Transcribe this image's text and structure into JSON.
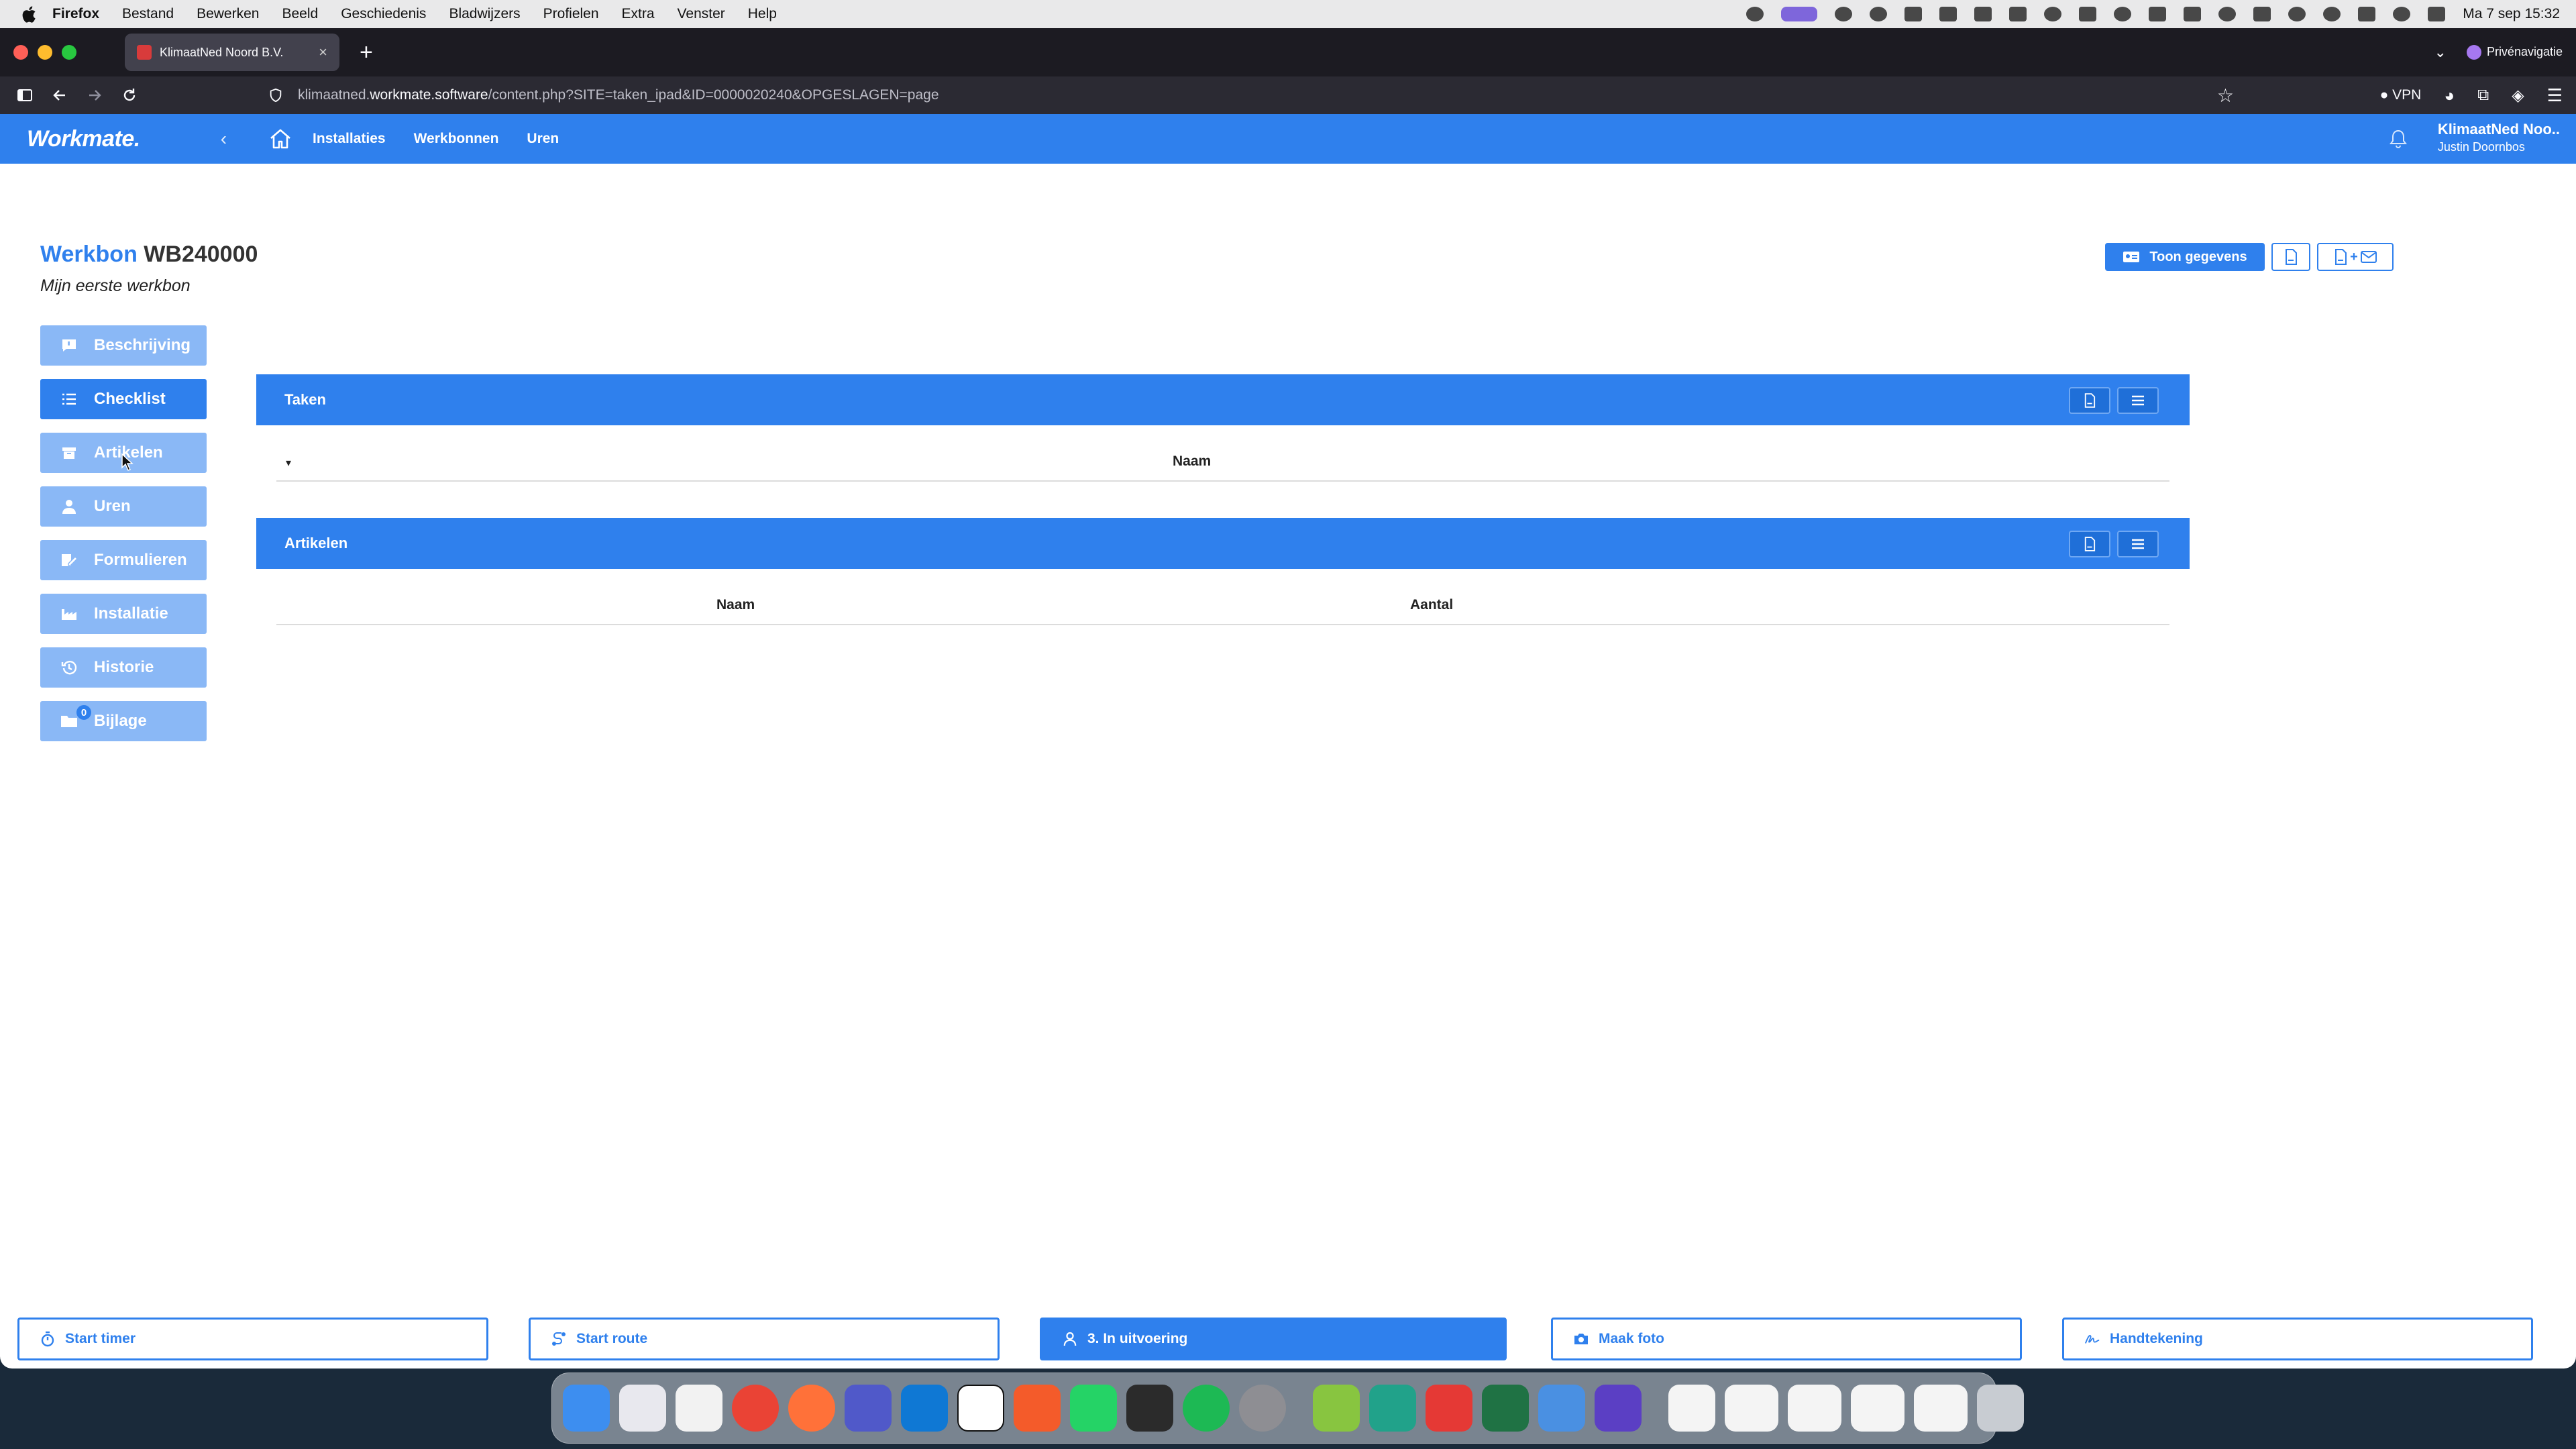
{
  "menubar": {
    "app": "Firefox",
    "items": [
      "Bestand",
      "Bewerken",
      "Beeld",
      "Geschiedenis",
      "Bladwijzers",
      "Profielen",
      "Extra",
      "Venster",
      "Help"
    ],
    "clock": "Ma 7 sep  15:32"
  },
  "browser": {
    "tab_title": "KlimaatNed Noord B.V.",
    "private_label": "Privénavigatie",
    "url_prefix": "klimaatned.",
    "url_host": "workmate.software",
    "url_path": "/content.php?SITE=taken_ipad&ID=0000020240&OPGESLAGEN=page",
    "vpn_label": "VPN"
  },
  "app": {
    "logo": "Workmate.",
    "nav": [
      "Installaties",
      "Werkbonnen",
      "Uren"
    ],
    "company": "KlimaatNed Noo..",
    "user": "Justin Doornbos"
  },
  "page": {
    "title_label": "Werkbon",
    "title_number": "WB240000",
    "subtitle": "Mijn eerste werkbon",
    "show_data_label": "Toon gegevens",
    "pdf_mail_label": "+"
  },
  "sidebar": {
    "items": [
      {
        "label": "Beschrijving",
        "icon": "comment-icon"
      },
      {
        "label": "Checklist",
        "icon": "list-icon"
      },
      {
        "label": "Artikelen",
        "icon": "box-icon"
      },
      {
        "label": "Uren",
        "icon": "user-icon"
      },
      {
        "label": "Formulieren",
        "icon": "form-icon"
      },
      {
        "label": "Installatie",
        "icon": "factory-icon"
      },
      {
        "label": "Historie",
        "icon": "history-icon"
      },
      {
        "label": "Bijlage",
        "icon": "folder-icon",
        "badge": "0"
      }
    ]
  },
  "panels": {
    "taken": {
      "title": "Taken",
      "col_name": "Naam"
    },
    "artikelen": {
      "title": "Artikelen",
      "col_name": "Naam",
      "col_qty": "Aantal"
    }
  },
  "bottom": {
    "start_timer": "Start timer",
    "start_route": "Start route",
    "status": "3. In uitvoering",
    "photo": "Maak foto",
    "signature": "Handtekening"
  },
  "colors": {
    "accent": "#2f80ed",
    "sidebar_inactive": "#8ab8f6"
  }
}
